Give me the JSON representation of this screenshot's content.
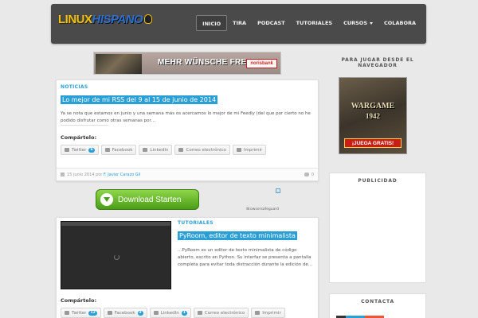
{
  "header": {
    "logo_part1": "LINUX",
    "logo_part2": "HISPANO",
    "nav": [
      {
        "label": "INICIO",
        "active": true
      },
      {
        "label": "TIRA"
      },
      {
        "label": "PODCAST"
      },
      {
        "label": "TUTORIALES"
      },
      {
        "label": "CURSOS",
        "dropdown": true
      },
      {
        "label": "COLABORA"
      }
    ]
  },
  "ads": {
    "top_banner_text": "MEHR WÜNSCHE FREI!",
    "top_banner_brand": "norisbank",
    "download_label": "Download Starten",
    "download_source": "Browsersafeguard",
    "info_icon": "i"
  },
  "posts": [
    {
      "category": "NOTICIAS",
      "title": "Lo mejor de mi RSS del 9 al 15 de junio de 2014",
      "excerpt": "Ya se nota que estamos en junio y una semana más os acercamos lo mejor de mi Feedly (del que por cierto no he podido disfrutar como otras semanas por…",
      "share_label": "Compártelo:",
      "share": [
        {
          "label": "Twitter",
          "count": "6"
        },
        {
          "label": "Facebook"
        },
        {
          "label": "LinkedIn"
        },
        {
          "label": "Correo electrónico"
        },
        {
          "label": "Imprimir"
        }
      ],
      "date": "15 junio 2014",
      "by": "por",
      "author": "F. Javier Carazo Gil",
      "comments": "0"
    },
    {
      "category": "TUTORIALES",
      "title": "PyRoom, editor de texto minimalista",
      "excerpt": "…PyRoom es un editor de texto minimalista de código abierto, escrito en Python. Su interfaz se presenta a pantalla completa para evitar toda distracción durante la edición de…",
      "share_label": "Compártelo:",
      "share": [
        {
          "label": "Twitter",
          "count": "12"
        },
        {
          "label": "Facebook",
          "count": "2"
        },
        {
          "label": "LinkedIn",
          "count": "1"
        },
        {
          "label": "Correo electrónico"
        },
        {
          "label": "Imprimir"
        }
      ]
    }
  ],
  "sidebar": {
    "browser_games_title": "PARA JUGAR DESDE EL NAVEGADOR",
    "game_title": "WARGAME",
    "game_year": "1942",
    "game_cta": "¡JUEGA GRATIS!",
    "ads_title": "PUBLICIDAD",
    "contact_title": "CONTACTA"
  },
  "colors": {
    "accent": "#2a9fd6",
    "navbar": "#4a4a4a",
    "background": "#e9e9e9"
  }
}
